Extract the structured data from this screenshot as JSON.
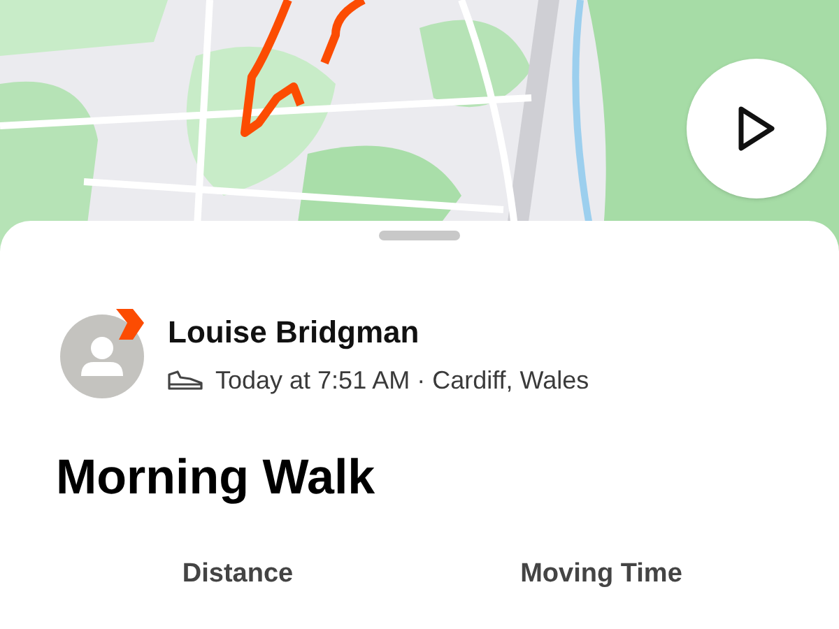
{
  "athlete": {
    "name": "Louise Bridgman",
    "when": "Today at 7:51 AM · Cardiff, Wales"
  },
  "activity": {
    "title": "Morning Walk"
  },
  "stats": [
    {
      "label": "Distance"
    },
    {
      "label": "Moving Time"
    }
  ]
}
